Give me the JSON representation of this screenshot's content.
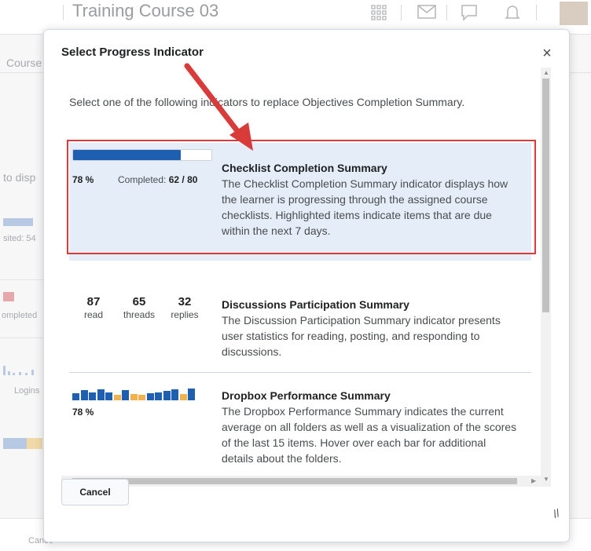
{
  "background": {
    "course_title": "Training Course 03",
    "nav_text": "Course",
    "left_labels": [
      "to disp",
      "sited: 54",
      "ompleted",
      "Logins"
    ],
    "footer_button": "Cance"
  },
  "dialog": {
    "title": "Select Progress Indicator",
    "close_label": "×",
    "intro": "Select one of the following indicators to replace Objectives Completion Summary.",
    "cancel_label": "Cancel",
    "resize_label": "//"
  },
  "options": {
    "checklist": {
      "title": "Checklist Completion Summary",
      "description": "The Checklist Completion Summary indicator displays how the learner is progressing through the assigned course checklists. Highlighted items indicate items that are due within the next 7 days.",
      "percent_label": "78 %",
      "completed_prefix": "Completed:",
      "completed_value": "62 / 80",
      "progress": 0.78
    },
    "discussions": {
      "title": "Discussions Participation Summary",
      "description": "The Discussion Participation Summary indicator presents user statistics for reading, posting, and responding to discussions.",
      "stats": [
        {
          "value": "87",
          "label": "read"
        },
        {
          "value": "65",
          "label": "threads"
        },
        {
          "value": "32",
          "label": "replies"
        }
      ]
    },
    "dropbox": {
      "title": "Dropbox Performance Summary",
      "description": "The Dropbox Performance Summary indicates the current average on all folders as well as a visualization of the scores of the last 15 items. Hover over each bar for additional details about the folders.",
      "percent_label": "78 %",
      "bar_colors": [
        "#1f5fb2",
        "#1f5fb2",
        "#1f5fb2",
        "#1f5fb2",
        "#1f5fb2",
        "#f2b24b",
        "#1f5fb2",
        "#f2b24b",
        "#f2b24b",
        "#1f5fb2",
        "#1f5fb2",
        "#1f5fb2",
        "#1f5fb2",
        "#f2b24b",
        "#1f5fb2"
      ],
      "bar_levels": [
        0.55,
        0.8,
        0.6,
        0.85,
        0.6,
        0.45,
        0.8,
        0.5,
        0.45,
        0.55,
        0.6,
        0.75,
        0.85,
        0.5,
        0.95
      ]
    }
  },
  "colors": {
    "accent": "#1f5fb2",
    "warning": "#f2b24b",
    "highlight_border": "#d93a3a",
    "selected_bg": "#e5eef8"
  }
}
